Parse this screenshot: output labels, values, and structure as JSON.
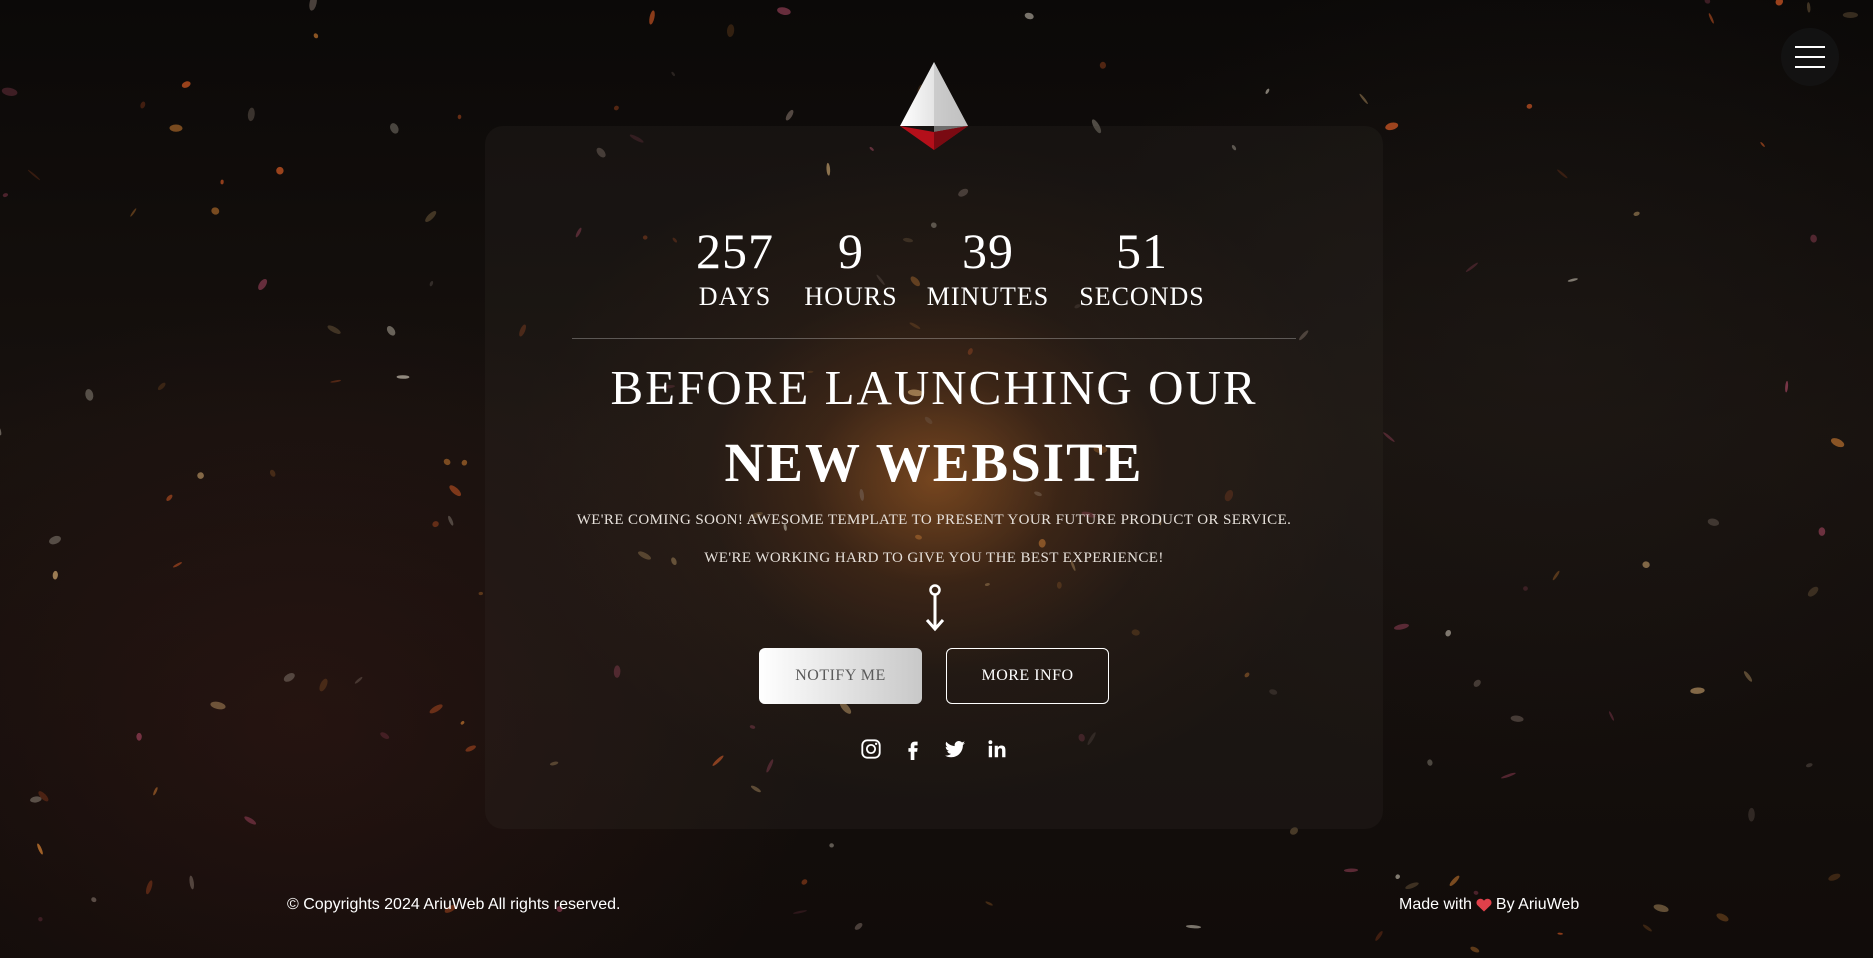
{
  "page": {
    "menu_icon": "hamburger-icon",
    "logo_icon": "pyramid-logo-icon"
  },
  "countdown": [
    {
      "value": "257",
      "label": "DAYS"
    },
    {
      "value": "9",
      "label": "HOURS"
    },
    {
      "value": "39",
      "label": "MINUTES"
    },
    {
      "value": "51",
      "label": "SECONDS"
    }
  ],
  "hero": {
    "headline_line1": "BEFORE LAUNCHING OUR",
    "headline_line2": "NEW WEBSITE",
    "subtitle_1": "WE'RE COMING SOON! AWESOME TEMPLATE TO PRESENT YOUR FUTURE PRODUCT OR SERVICE.",
    "subtitle_2": "WE'RE WORKING HARD TO GIVE YOU THE BEST EXPERIENCE!",
    "arrow_icon": "arrow-down-icon"
  },
  "buttons": {
    "notify_label": "NOTIFY ME",
    "more_info_label": "MORE INFO"
  },
  "socials": [
    {
      "name": "instagram-icon"
    },
    {
      "name": "facebook-icon"
    },
    {
      "name": "twitter-icon"
    },
    {
      "name": "linkedin-icon"
    }
  ],
  "footer": {
    "copyright": "© Copyrights 2024 AriuWeb All rights reserved.",
    "made_with": "Made with",
    "by": "By AriuWeb",
    "heart_color": "#e0404a"
  },
  "colors": {
    "accent_red": "#c0121c",
    "text": "#ffffff"
  }
}
